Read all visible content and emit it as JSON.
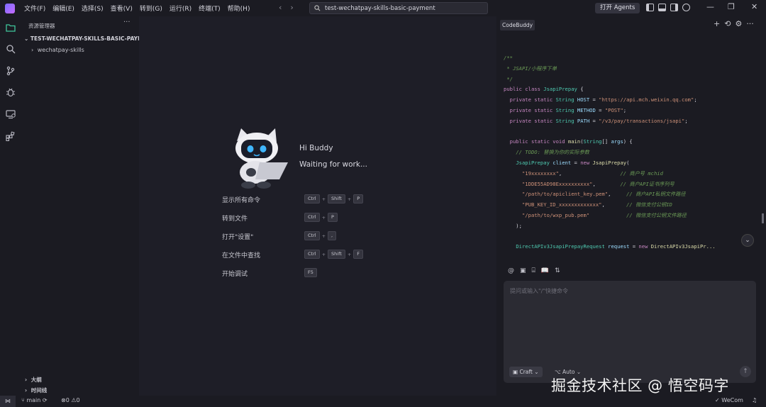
{
  "titlebar": {
    "menus": [
      "文件(F)",
      "编辑(E)",
      "选择(S)",
      "查看(V)",
      "转到(G)",
      "运行(R)",
      "终端(T)",
      "帮助(H)"
    ],
    "search_text": "test-wechatpay-skills-basic-payment",
    "agents_label": "打开 Agents",
    "back_glyph": "‹",
    "forward_glyph": "›",
    "minimize_glyph": "—",
    "maximize_glyph": "❐",
    "close_glyph": "✕"
  },
  "activity_icons": [
    "explorer-icon",
    "search-icon",
    "source-control-icon",
    "debug-icon",
    "remote-explorer-icon",
    "extensions-icon"
  ],
  "explorer": {
    "title": "资源管理器",
    "more": "···",
    "project": "TEST-WECHATPAY-SKILLS-BASIC-PAYM...",
    "folder": "wechatpay-skills",
    "outline": "大纲",
    "timeline": "时间线"
  },
  "welcome": {
    "greeting": "Hi Buddy",
    "status": "Waiting for work...",
    "shortcuts": [
      {
        "label": "显示所有命令",
        "keys": [
          "Ctrl",
          "Shift",
          "P"
        ]
      },
      {
        "label": "转到文件",
        "keys": [
          "Ctrl",
          "P"
        ]
      },
      {
        "label": "打开\"设置\"",
        "keys": [
          "Ctrl",
          ","
        ]
      },
      {
        "label": "在文件中查找",
        "keys": [
          "Ctrl",
          "Shift",
          "F"
        ]
      },
      {
        "label": "开始调试",
        "keys": [
          "F5"
        ]
      }
    ]
  },
  "panel": {
    "tab": "CodeBuddy",
    "tools": [
      "+",
      "⟲",
      "⚙",
      "···"
    ],
    "code_lines": [
      [
        [
          "c",
          "/**"
        ]
      ],
      [
        [
          "c",
          " * JSAPI/小程序下单"
        ]
      ],
      [
        [
          "c",
          " */"
        ]
      ],
      [
        [
          "k",
          "public class "
        ],
        [
          "t",
          "JsapiPrepay"
        ],
        [
          "p",
          " {"
        ]
      ],
      [
        [
          "p",
          "  "
        ],
        [
          "k",
          "private static "
        ],
        [
          "t",
          "String "
        ],
        [
          "v",
          "HOST"
        ],
        [
          "p",
          " = "
        ],
        [
          "s",
          "\"https://api.mch.weixin.qq.com\""
        ],
        [
          "p",
          ";"
        ]
      ],
      [
        [
          "p",
          "  "
        ],
        [
          "k",
          "private static "
        ],
        [
          "t",
          "String "
        ],
        [
          "v",
          "METHOD"
        ],
        [
          "p",
          " = "
        ],
        [
          "s",
          "\"POST\""
        ],
        [
          "p",
          ";"
        ]
      ],
      [
        [
          "p",
          "  "
        ],
        [
          "k",
          "private static "
        ],
        [
          "t",
          "String "
        ],
        [
          "v",
          "PATH"
        ],
        [
          "p",
          " = "
        ],
        [
          "s",
          "\"/v3/pay/transactions/jsapi\""
        ],
        [
          "p",
          ";"
        ]
      ],
      [
        [
          "p",
          ""
        ]
      ],
      [
        [
          "p",
          "  "
        ],
        [
          "k",
          "public static void "
        ],
        [
          "f",
          "main"
        ],
        [
          "p",
          "("
        ],
        [
          "t",
          "String"
        ],
        [
          "p",
          "[] "
        ],
        [
          "v",
          "args"
        ],
        [
          "p",
          ") {"
        ]
      ],
      [
        [
          "p",
          "    "
        ],
        [
          "c",
          "// TODO: 替换为你的实际参数"
        ]
      ],
      [
        [
          "p",
          "    "
        ],
        [
          "t",
          "JsapiPrepay "
        ],
        [
          "v",
          "client"
        ],
        [
          "p",
          " = "
        ],
        [
          "k",
          "new "
        ],
        [
          "f",
          "JsapiPrepay"
        ],
        [
          "p",
          "("
        ]
      ],
      [
        [
          "p",
          "      "
        ],
        [
          "s",
          "\"19xxxxxxxx\""
        ],
        [
          "p",
          ",                   "
        ],
        [
          "c",
          "// 商户号 mchid"
        ]
      ],
      [
        [
          "p",
          "      "
        ],
        [
          "s",
          "\"1DDE55AD98Exxxxxxxxxx\""
        ],
        [
          "p",
          ",        "
        ],
        [
          "c",
          "// 商户API证书序列号"
        ]
      ],
      [
        [
          "p",
          "      "
        ],
        [
          "s",
          "\"/path/to/apiclient_key.pem\""
        ],
        [
          "p",
          ",     "
        ],
        [
          "c",
          "// 商户API私钥文件路径"
        ]
      ],
      [
        [
          "p",
          "      "
        ],
        [
          "s",
          "\"PUB_KEY_ID_xxxxxxxxxxxxx\""
        ],
        [
          "p",
          ",       "
        ],
        [
          "c",
          "// 微信支付公钥ID"
        ]
      ],
      [
        [
          "p",
          "      "
        ],
        [
          "s",
          "\"/path/to/wxp_pub.pem\""
        ],
        [
          "p",
          "            "
        ],
        [
          "c",
          "// 微信支付公钥文件路径"
        ]
      ],
      [
        [
          "p",
          "    );"
        ]
      ],
      [
        [
          "p",
          ""
        ]
      ],
      [
        [
          "p",
          "    "
        ],
        [
          "t",
          "DirectAPIv3JsapiPrepayRequest "
        ],
        [
          "v",
          "request"
        ],
        [
          "p",
          " = "
        ],
        [
          "k",
          "new "
        ],
        [
          "f",
          "DirectAPIv3JsapiPr..."
        ]
      ]
    ],
    "chat_tools": [
      "@",
      "▣",
      "⌸",
      "📖",
      "⇅"
    ],
    "placeholder": "提问或输入\"/\"快捷命令",
    "mode": "Craft",
    "model": "Auto",
    "send": "↑"
  },
  "statusbar": {
    "branch": "main",
    "errors": "0",
    "warnings": "0",
    "wecom": "WeCom"
  },
  "watermark": "掘金技术社区 @ 悟空码字",
  "colors": {
    "accent": "#7b6cff",
    "background": "#1e1e27",
    "sidebar": "#1b1b22"
  }
}
